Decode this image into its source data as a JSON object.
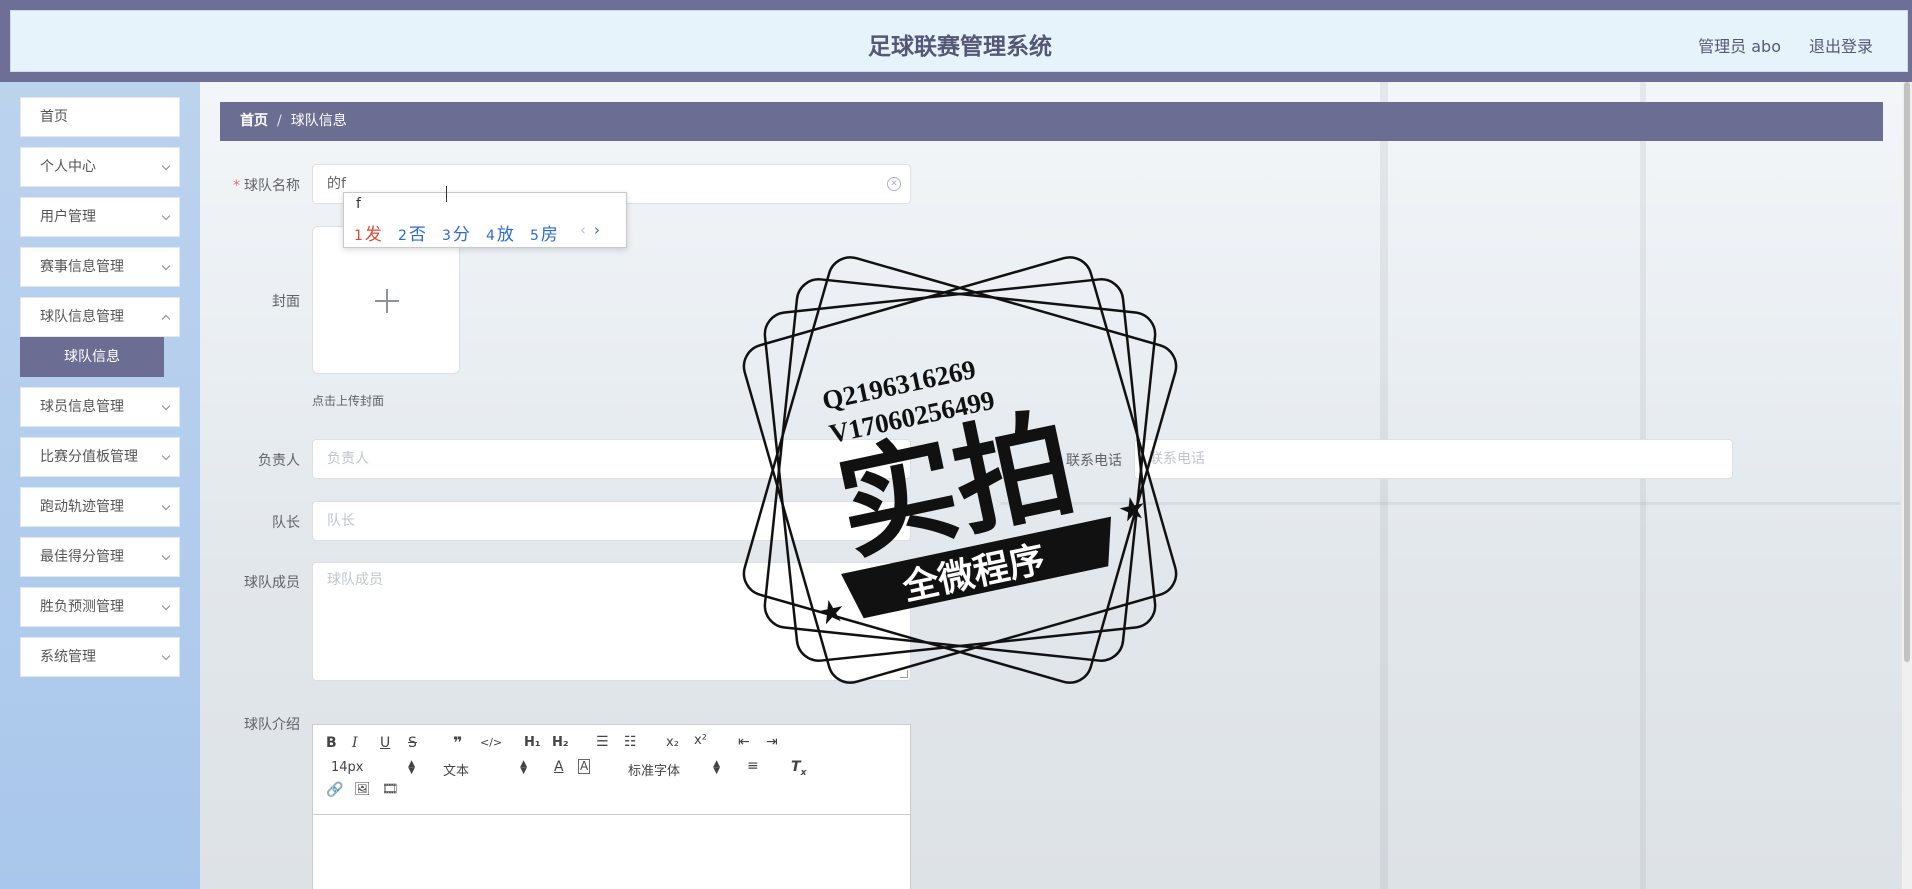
{
  "header": {
    "title": "足球联赛管理系统",
    "user": "管理员 abo",
    "logout": "退出登录"
  },
  "sidebar": {
    "items": [
      {
        "label": "首页"
      },
      {
        "label": "个人中心"
      },
      {
        "label": "用户管理"
      },
      {
        "label": "赛事信息管理"
      },
      {
        "label": "球队信息管理"
      },
      {
        "label": "球员信息管理"
      },
      {
        "label": "比赛分值板管理"
      },
      {
        "label": "跑动轨迹管理"
      },
      {
        "label": "最佳得分管理"
      },
      {
        "label": "胜负预测管理"
      },
      {
        "label": "系统管理"
      }
    ],
    "active_sub": "球队信息"
  },
  "breadcrumb": {
    "home": "首页",
    "separator": "/",
    "current": "球队信息"
  },
  "form": {
    "name": {
      "label": "球队名称",
      "value": "的f"
    },
    "cover": {
      "label": "封面",
      "tip": "点击上传封面"
    },
    "leader": {
      "label": "负责人",
      "placeholder": "负责人"
    },
    "phone": {
      "label": "联系电话",
      "placeholder": "联系电话"
    },
    "captain": {
      "label": "队长",
      "placeholder": "队长"
    },
    "members": {
      "label": "球队成员",
      "placeholder": "球队成员"
    },
    "intro": {
      "label": "球队介绍"
    }
  },
  "editor": {
    "font_size": "14px",
    "paragraph": "文本",
    "font_family": "标准字体"
  },
  "ime": {
    "composition": "f",
    "candidates": [
      {
        "num": "1",
        "text": "发"
      },
      {
        "num": "2",
        "text": "否"
      },
      {
        "num": "3",
        "text": "分"
      },
      {
        "num": "4",
        "text": "放"
      },
      {
        "num": "5",
        "text": "房"
      }
    ]
  },
  "watermark": {
    "line1": "Q2196316269",
    "line2": "V17060256499",
    "big": "实拍",
    "banner": "全微程序"
  }
}
